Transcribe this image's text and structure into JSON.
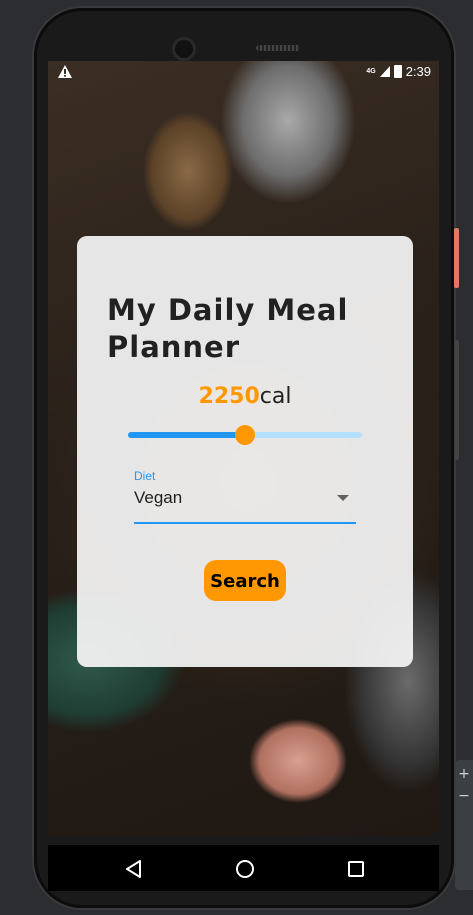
{
  "status_bar": {
    "network": "4G",
    "time": "2:39"
  },
  "card": {
    "title": "My Daily Meal Planner",
    "calories": {
      "value": "2250",
      "unit": "cal",
      "slider_fraction": 0.5
    },
    "diet": {
      "label": "Diet",
      "value": "Vegan"
    },
    "search_button": "Search"
  },
  "colors": {
    "accent": "#ff9800",
    "primary": "#2196f3",
    "slider_track": "#b3e0fb",
    "card_background": "#f5f5f5"
  },
  "icons": {
    "status_warning": "warning-icon",
    "status_signal": "signal-icon",
    "status_battery": "battery-icon",
    "nav_back": "back-icon",
    "nav_home": "home-icon",
    "nav_recent": "recent-apps-icon",
    "diet_dropdown": "chevron-down-icon"
  }
}
